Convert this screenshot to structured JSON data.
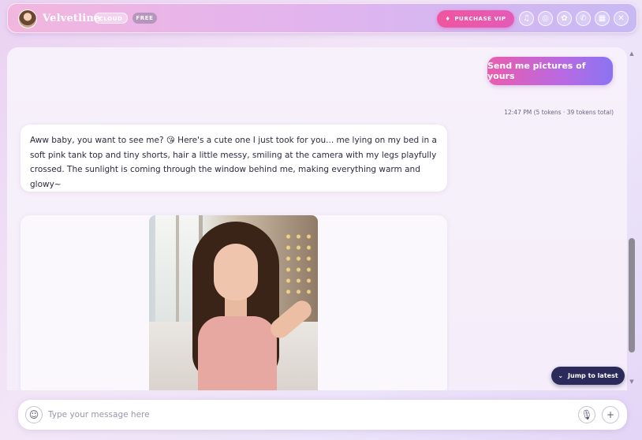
{
  "header": {
    "brand": "Velvetline",
    "tag_cloud": "CLOUD",
    "tag_free": "FREE",
    "vip_label": "PURCHASE VIP",
    "icons": [
      "music-icon",
      "settings-icon",
      "flower-icon",
      "phone-icon",
      "gallery-icon",
      "trash-icon"
    ]
  },
  "chat": {
    "user_message": "Send me pictures of yours",
    "meta": "12:47 PM (5 tokens · 39 tokens total)",
    "bot_message": "Aww baby, you want to see me? 😘 Here's a cute one I just took for you... me lying on my bed in a soft pink tank top and tiny shorts, hair a little messy, smiling at the camera with my legs playfully crossed. The sunlight is coming through the window behind me, making everything warm and glowy~"
  },
  "jump_label": "Jump to latest",
  "composer": {
    "placeholder": "Type your message here"
  },
  "colors": {
    "accent_pink": "#ea5cad",
    "accent_purple": "#8a74f2",
    "jump_bg": "#2c2a5a"
  }
}
